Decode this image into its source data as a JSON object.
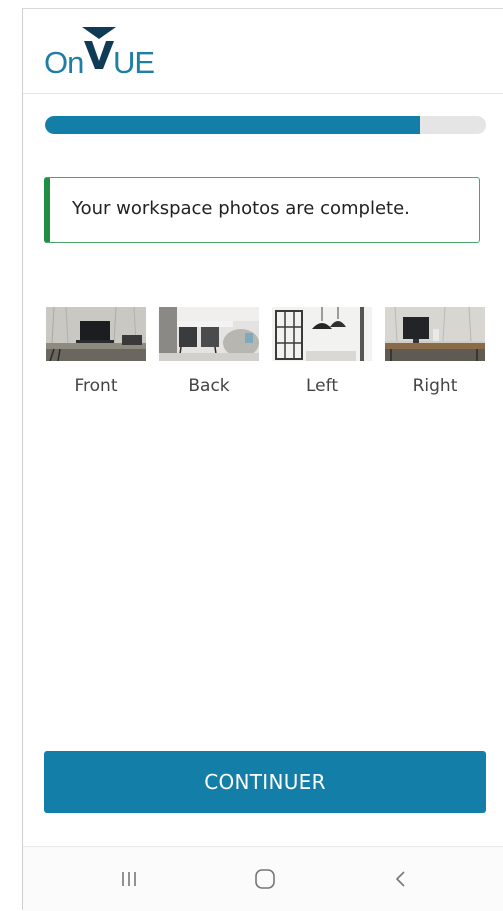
{
  "logo": {
    "text_left": "On",
    "text_right": "UE",
    "color": "#1f7ea3"
  },
  "progress": {
    "value": 0.85,
    "color": "#137ea7"
  },
  "alert": {
    "message": "Your workspace photos are complete.",
    "color": "#1e8f45"
  },
  "photos": [
    {
      "label": "Front",
      "icon": "front-photo"
    },
    {
      "label": "Back",
      "icon": "back-photo"
    },
    {
      "label": "Left",
      "icon": "left-photo"
    },
    {
      "label": "Right",
      "icon": "right-photo"
    }
  ],
  "continue_button": {
    "label": "CONTINUER",
    "color": "#137ea7"
  },
  "navbar": {
    "icons": [
      "recent-apps-icon",
      "home-icon",
      "back-icon"
    ]
  }
}
